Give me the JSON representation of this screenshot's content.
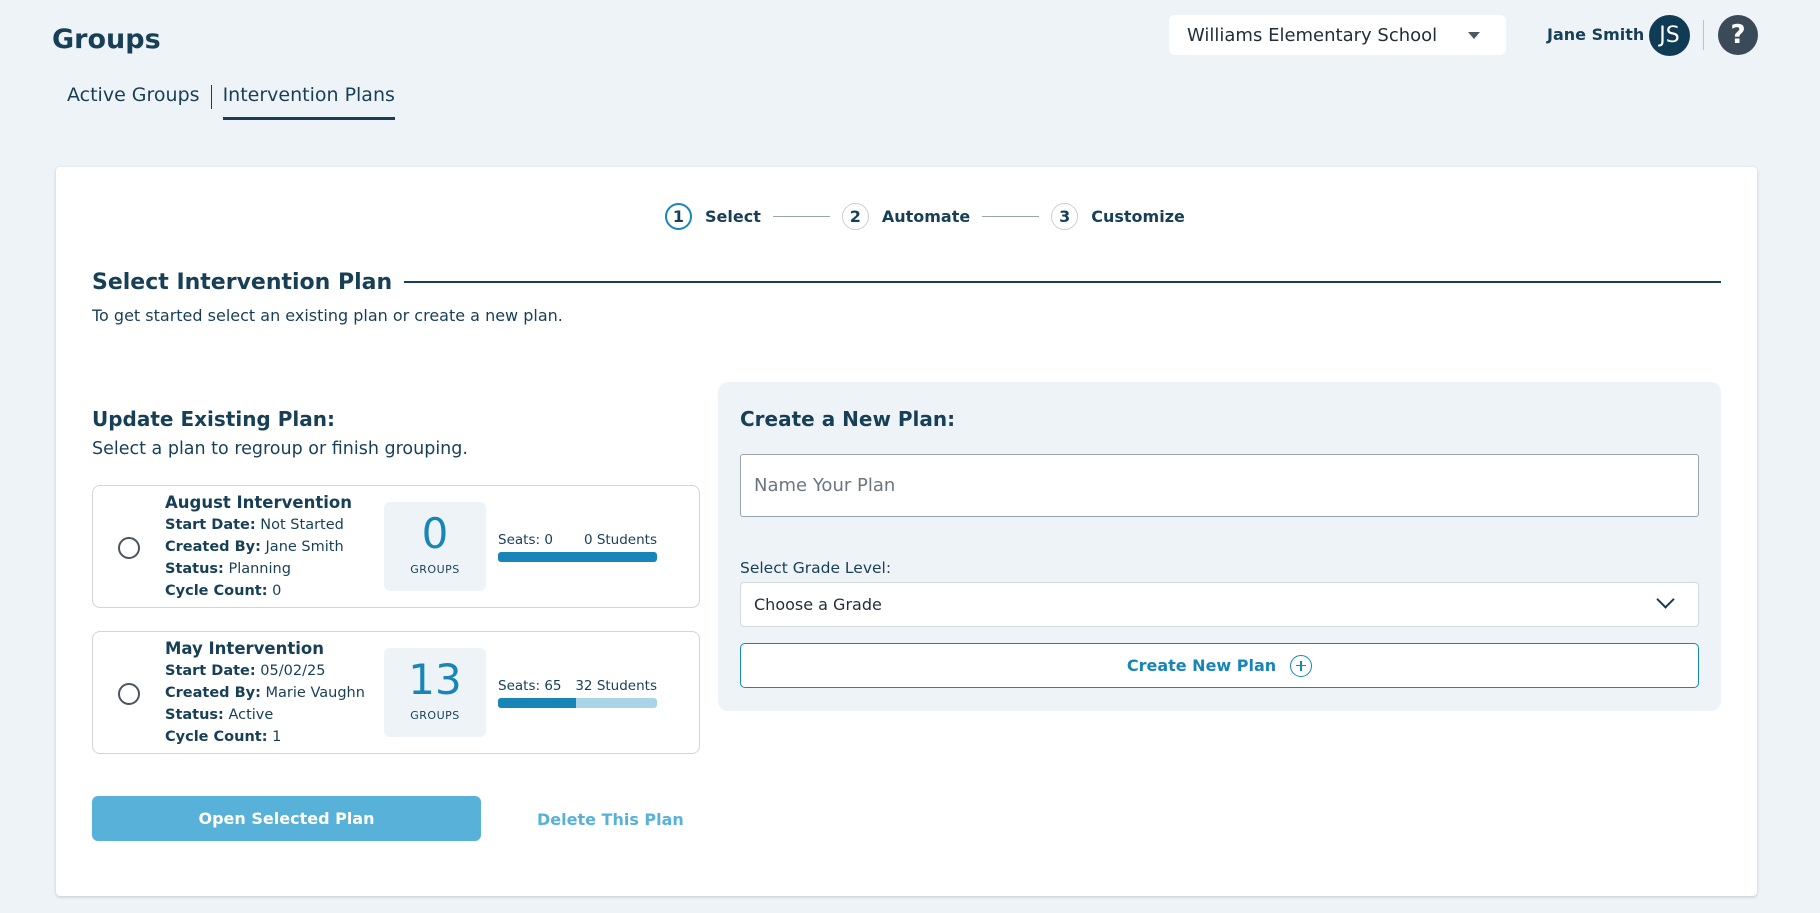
{
  "header": {
    "title": "Groups",
    "school_select": "Williams Elementary School",
    "user_name": "Jane Smith",
    "avatar_initials": "JS",
    "help_symbol": "?"
  },
  "tabs": [
    {
      "label": "Active Groups",
      "active": false
    },
    {
      "label": "Intervention Plans",
      "active": true
    }
  ],
  "stepper": [
    {
      "num": "1",
      "label": "Select",
      "current": true
    },
    {
      "num": "2",
      "label": "Automate",
      "current": false
    },
    {
      "num": "3",
      "label": "Customize",
      "current": false
    }
  ],
  "section": {
    "title": "Select Intervention Plan",
    "description": "To get started select an existing plan or create a new plan."
  },
  "update": {
    "title": "Update Existing Plan:",
    "description": "Select a plan to regroup or finish grouping.",
    "start_label": "Start Date:",
    "created_label": "Created By:",
    "status_label": "Status:",
    "cycle_label": "Cycle Count:",
    "groups_label": "GROUPS",
    "plans": [
      {
        "name": "August Intervention",
        "start_date": "Not Started",
        "created_by": "Jane Smith",
        "status": "Planning",
        "cycle_count": "0",
        "groups": "0",
        "seats": "Seats: 0",
        "students": "0 Students",
        "seat_fill_fraction": 1.0
      },
      {
        "name": "May Intervention",
        "start_date": "05/02/25",
        "created_by": "Marie Vaughn",
        "status": "Active",
        "cycle_count": "1",
        "groups": "13",
        "seats": "Seats: 65",
        "students": "32 Students",
        "seat_fill_fraction": 0.49
      }
    ],
    "open_button": "Open Selected Plan",
    "delete_link": "Delete This Plan"
  },
  "create": {
    "title": "Create a New Plan:",
    "name_placeholder": "Name Your Plan",
    "grade_label": "Select Grade Level:",
    "grade_value": "Choose a Grade",
    "create_button": "Create New Plan"
  },
  "colors": {
    "background": "#eef3f7",
    "primary_text": "#173f56",
    "accent": "#1785b8",
    "accent_light": "#58b1d9",
    "seat_bar_empty": "#a9d4e8"
  }
}
